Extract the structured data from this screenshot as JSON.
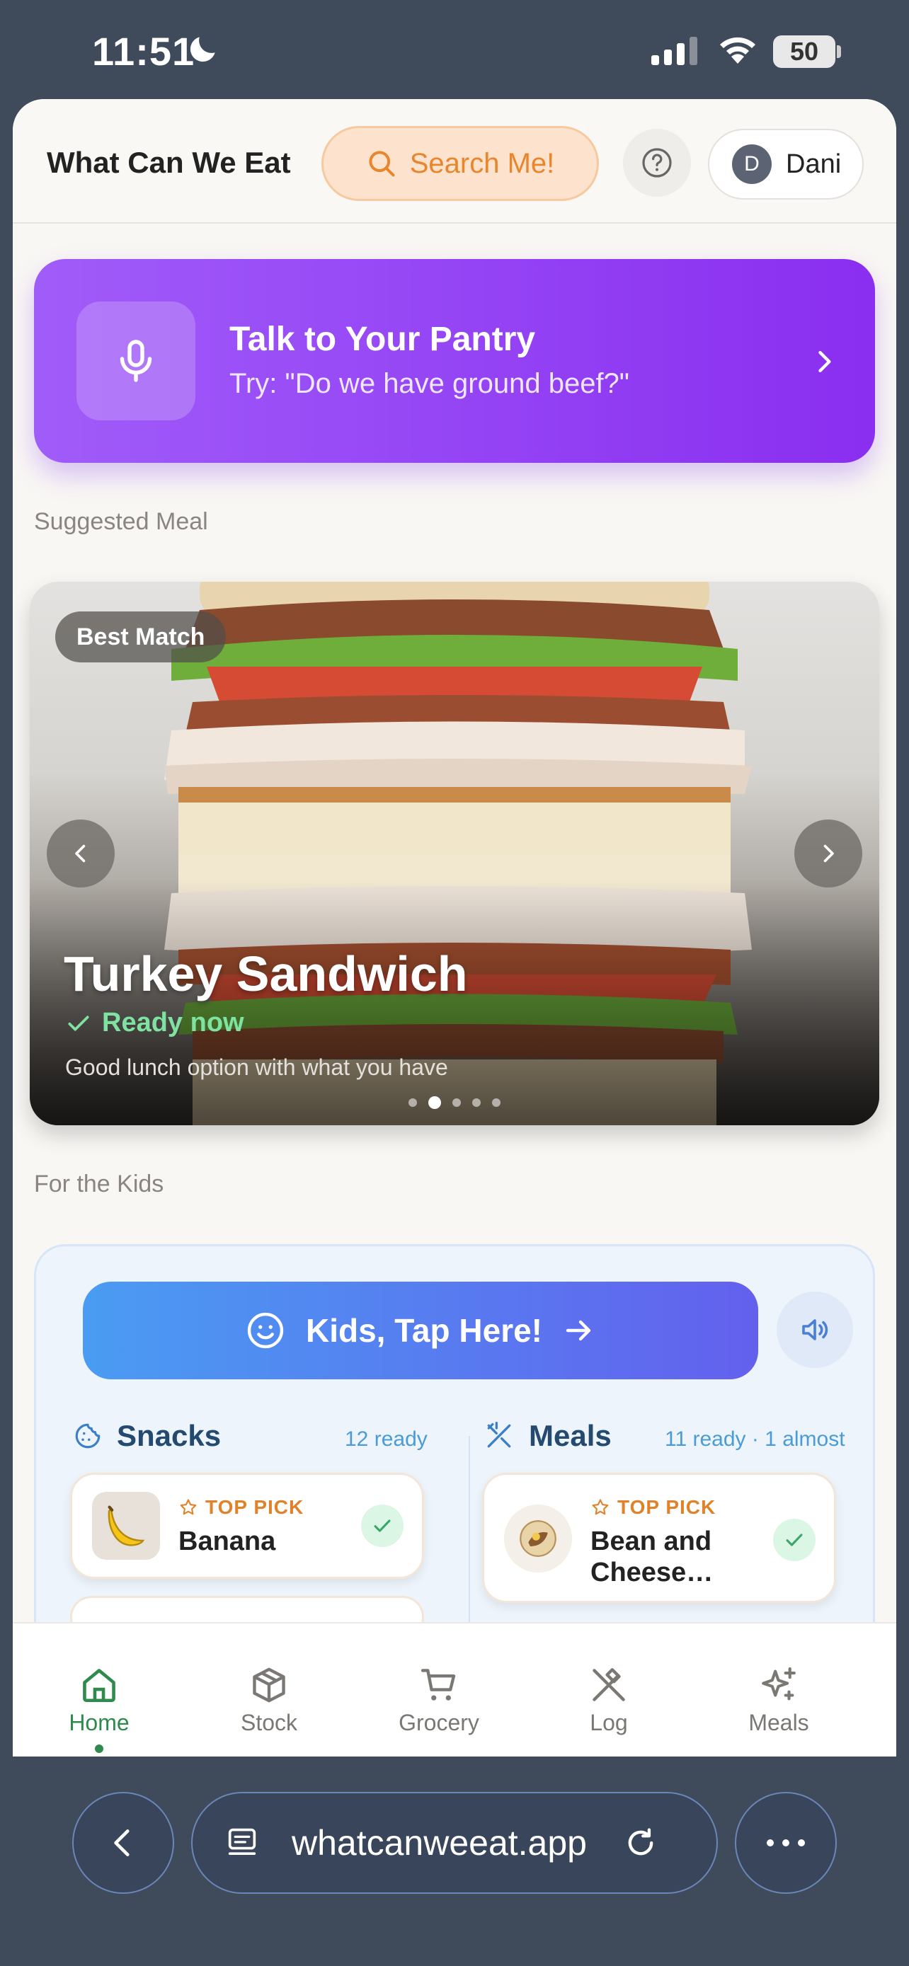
{
  "status_bar": {
    "time": "11:51",
    "battery": "50"
  },
  "header": {
    "app_title": "What Can We Eat",
    "search_label": "Search Me!",
    "user_initial": "D",
    "user_name": "Dani"
  },
  "pantry_banner": {
    "title": "Talk to Your Pantry",
    "subtitle": "Try: \"Do we have ground beef?\""
  },
  "suggested": {
    "section_label": "Suggested Meal",
    "badge": "Best Match",
    "meal_name": "Turkey Sandwich",
    "status": "Ready now",
    "description": "Good lunch option with what you have",
    "carousel_total": 5,
    "carousel_active": 2
  },
  "kids": {
    "section_label": "For the Kids",
    "tap_label": "Kids, Tap Here!",
    "snacks": {
      "title": "Snacks",
      "count": "12 ready",
      "item": {
        "tag": "TOP PICK",
        "name": "Banana"
      }
    },
    "meals": {
      "title": "Meals",
      "count": "11 ready · 1 almost",
      "item": {
        "tag": "TOP PICK",
        "name": "Bean and Cheese…"
      }
    }
  },
  "tabs": [
    {
      "label": "Home",
      "icon": "home-icon",
      "active": true
    },
    {
      "label": "Stock",
      "icon": "box-icon",
      "active": false
    },
    {
      "label": "Grocery",
      "icon": "cart-icon",
      "active": false
    },
    {
      "label": "Log",
      "icon": "utensils-icon",
      "active": false
    },
    {
      "label": "Meals",
      "icon": "sparkles-icon",
      "active": false
    }
  ],
  "browser": {
    "url": "whatcanweeat.app"
  },
  "colors": {
    "accent_green": "#2f8a4d",
    "pantry_purple": "#8a2ef0",
    "search_orange": "#e9852c",
    "kids_blue": "#4a9cf2"
  }
}
